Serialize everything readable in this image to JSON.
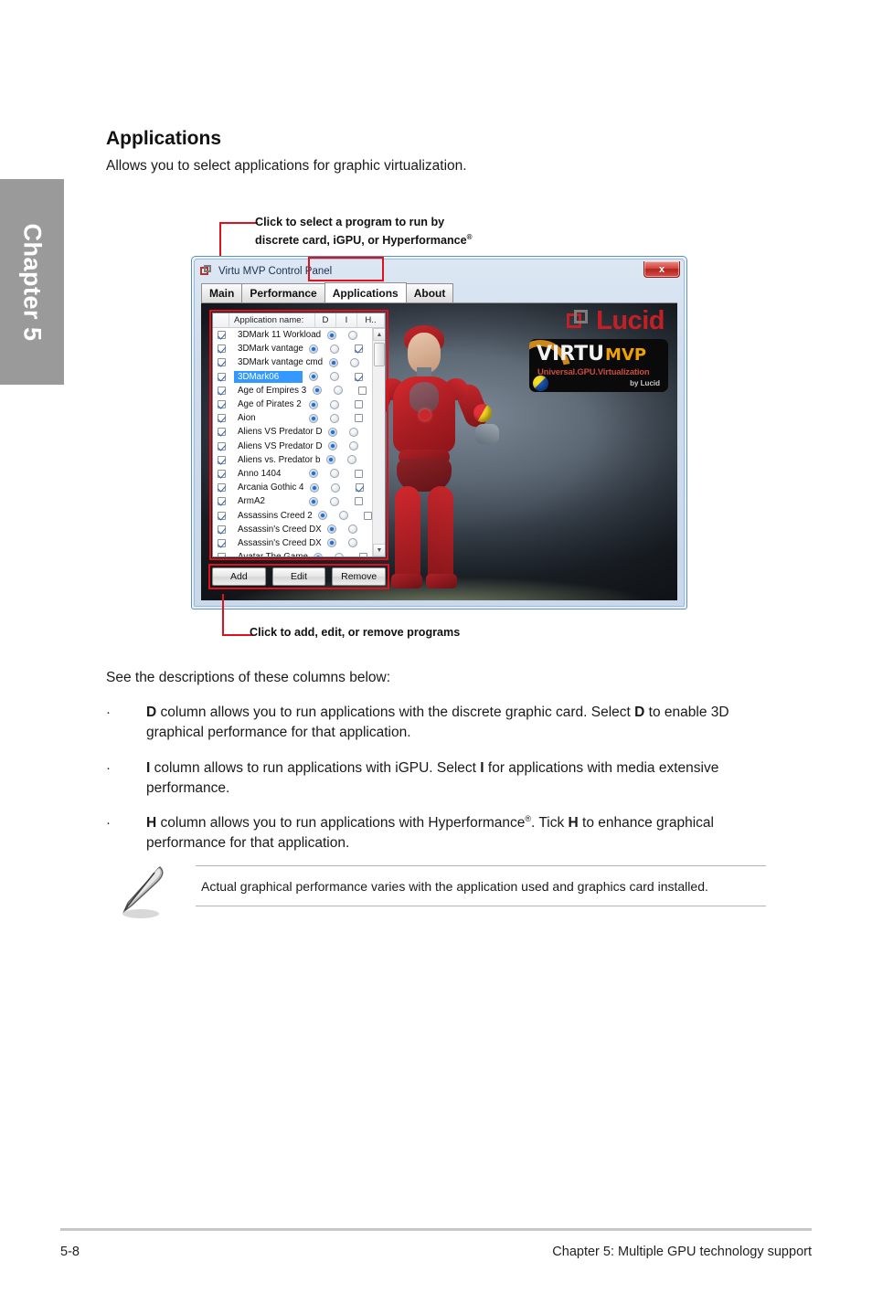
{
  "chapter_tab": {
    "label": "Chapter 5"
  },
  "page": {
    "title": "Applications",
    "intro": "Allows you to select applications for graphic virtualization.",
    "see_descriptions": "See the descriptions of these columns below:",
    "bullets": [
      {
        "marker": "·",
        "text_a": "D",
        "text_b": " column allows you to run applications with the discrete graphic card. Select ",
        "text_c": "D",
        "text_d": " to enable 3D graphical performance for that application."
      },
      {
        "marker": "·",
        "text_a": "I",
        "text_b": " column allows to run applications with iGPU. Select ",
        "text_c": "I",
        "text_d": " for applications with media extensive performance."
      },
      {
        "marker": "·",
        "text_a": "H",
        "text_b": " column allows you to run applications with Hyperformance",
        "sup": "®",
        "text_c": ". Tick ",
        "text_d": "H",
        "text_e": " to enhance graphical performance for that application."
      }
    ],
    "note": "Actual graphical performance varies with the application used and graphics card installed."
  },
  "callouts": {
    "top_line1": "Click to select a program to run by",
    "top_line2": "discrete card, iGPU, or Hyperformance",
    "top_sup": "®",
    "bottom": "Click to add, edit, or remove programs"
  },
  "app_window": {
    "title": "Virtu MVP Control Panel",
    "close_label": "x",
    "tabs": [
      {
        "label": "Main",
        "active": false
      },
      {
        "label": "Performance",
        "active": false
      },
      {
        "label": "Applications",
        "active": true
      },
      {
        "label": "About",
        "active": false
      }
    ],
    "list": {
      "columns": [
        "",
        "Application name:",
        "D",
        "I",
        "H.."
      ],
      "rows": [
        {
          "name": "3DMark 11 Workload",
          "enabled": true,
          "d": true,
          "i": false,
          "h": true,
          "selected": false
        },
        {
          "name": "3DMark vantage",
          "enabled": true,
          "d": true,
          "i": false,
          "h": true,
          "selected": false
        },
        {
          "name": "3DMark vantage cmd",
          "enabled": true,
          "d": true,
          "i": false,
          "h": true,
          "selected": false
        },
        {
          "name": "3DMark06",
          "enabled": true,
          "d": true,
          "i": false,
          "h": true,
          "selected": true
        },
        {
          "name": "Age of Empires 3",
          "enabled": true,
          "d": true,
          "i": false,
          "h": false,
          "selected": false
        },
        {
          "name": "Age of Pirates 2",
          "enabled": true,
          "d": true,
          "i": false,
          "h": false,
          "selected": false
        },
        {
          "name": "Aion",
          "enabled": true,
          "d": true,
          "i": false,
          "h": false,
          "selected": false
        },
        {
          "name": "Aliens VS Predator D",
          "enabled": true,
          "d": true,
          "i": false,
          "h": false,
          "selected": false
        },
        {
          "name": "Aliens VS Predator D",
          "enabled": true,
          "d": true,
          "i": false,
          "h": false,
          "selected": false
        },
        {
          "name": "Aliens vs. Predator b",
          "enabled": true,
          "d": true,
          "i": false,
          "h": false,
          "selected": false
        },
        {
          "name": "Anno 1404",
          "enabled": true,
          "d": true,
          "i": false,
          "h": false,
          "selected": false
        },
        {
          "name": "Arcania Gothic 4",
          "enabled": true,
          "d": true,
          "i": false,
          "h": true,
          "selected": false
        },
        {
          "name": "ArmA2",
          "enabled": true,
          "d": true,
          "i": false,
          "h": false,
          "selected": false
        },
        {
          "name": "Assassins Creed 2",
          "enabled": true,
          "d": true,
          "i": false,
          "h": false,
          "selected": false
        },
        {
          "name": "Assassin's Creed DX",
          "enabled": true,
          "d": true,
          "i": false,
          "h": false,
          "selected": false
        },
        {
          "name": "Assassin's Creed DX",
          "enabled": true,
          "d": true,
          "i": false,
          "h": false,
          "selected": false
        },
        {
          "name": "Avatar The Game",
          "enabled": true,
          "d": true,
          "i": false,
          "h": false,
          "selected": false
        }
      ]
    },
    "buttons": [
      {
        "label": "Add"
      },
      {
        "label": "Edit"
      },
      {
        "label": "Remove"
      }
    ],
    "branding": {
      "lucid": "Lucid",
      "virtu": "VIRTU",
      "mvp": "MVP",
      "tagline": "Universal.GPU.Virtualization",
      "byline": "by Lucid"
    }
  },
  "footer": {
    "page_number": "5-8",
    "chapter_title": "Chapter 5: Multiple GPU technology support"
  },
  "colors": {
    "accent_red": "#e1111b",
    "lucid_red": "#c32026",
    "selection_blue": "#3399ff",
    "tab_gray": "#9a9a9a"
  }
}
